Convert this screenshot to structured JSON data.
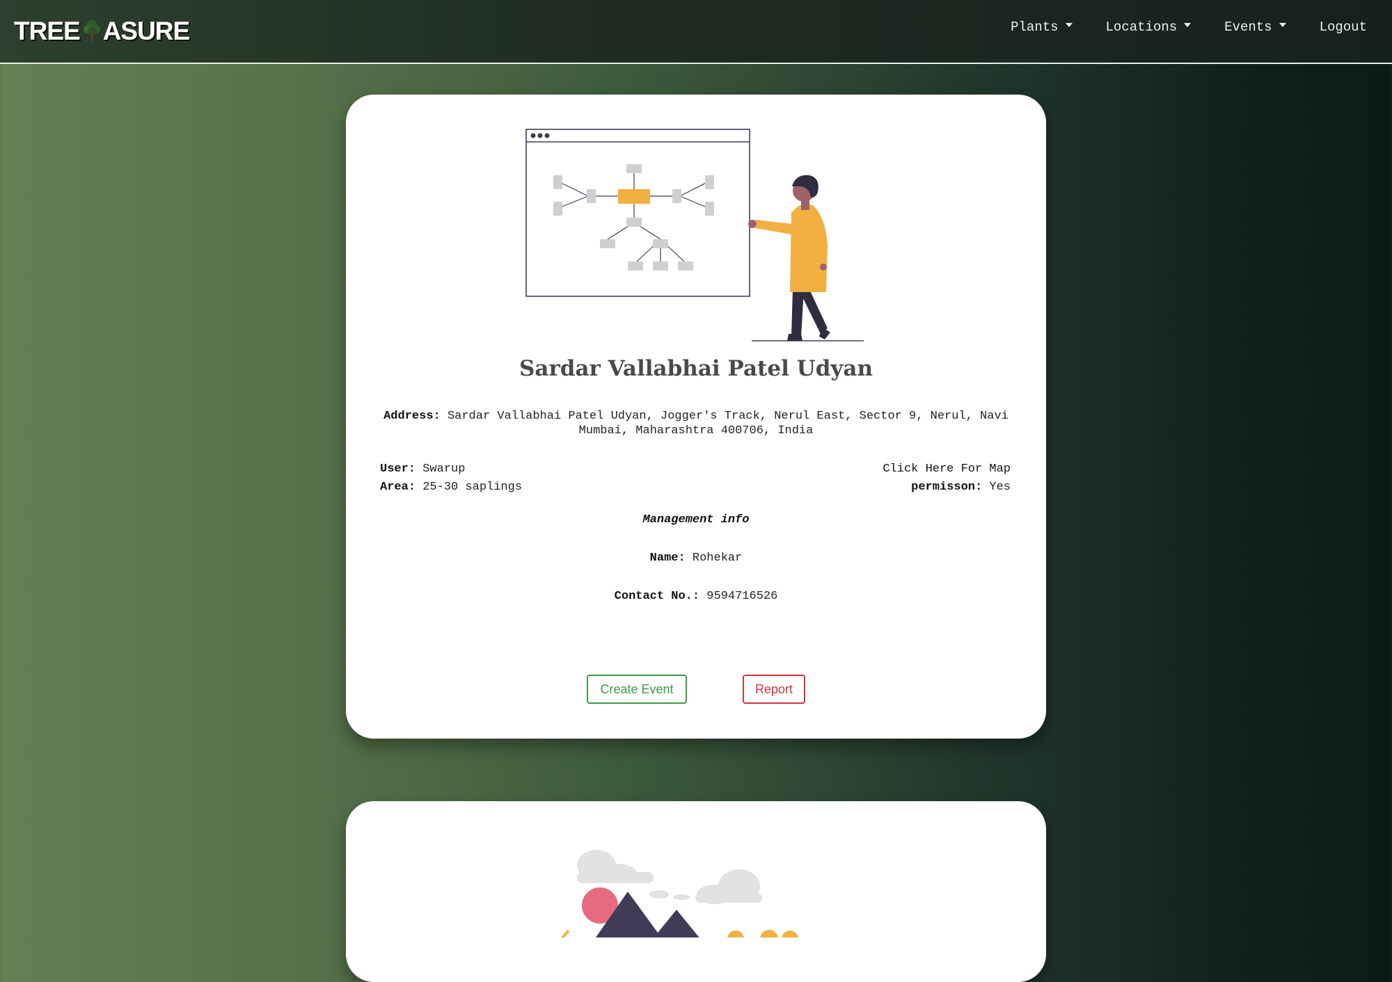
{
  "navbar": {
    "brand_left": "TREE",
    "brand_right": "ASURE",
    "items": [
      {
        "label": "Plants",
        "dropdown": true
      },
      {
        "label": "Locations",
        "dropdown": true
      },
      {
        "label": "Events",
        "dropdown": true
      },
      {
        "label": "Logout",
        "dropdown": false
      }
    ]
  },
  "location": {
    "title": "Sardar Vallabhai Patel Udyan",
    "address_label": "Address:",
    "address_value": "Sardar Vallabhai Patel Udyan, Jogger's Track, Nerul East, Sector 9, Nerul, Navi Mumbai, Maharashtra 400706, India",
    "user_label": "User:",
    "user_value": "Swarup",
    "area_label": "Area:",
    "area_value": "25-30 saplings",
    "map_link": "Click Here For Map",
    "permission_label": "permisson:",
    "permission_value": "Yes"
  },
  "management": {
    "title": "Management info",
    "name_label": "Name:",
    "name_value": "Rohekar",
    "contact_label": "Contact No.:",
    "contact_value": "9594716526"
  },
  "actions": {
    "create_event": "Create Event",
    "report": "Report"
  },
  "colors": {
    "accent_orange": "#f2b042",
    "create_green": "#3c9a48",
    "report_red": "#d0343e",
    "dark_figure": "#2f2e41"
  }
}
